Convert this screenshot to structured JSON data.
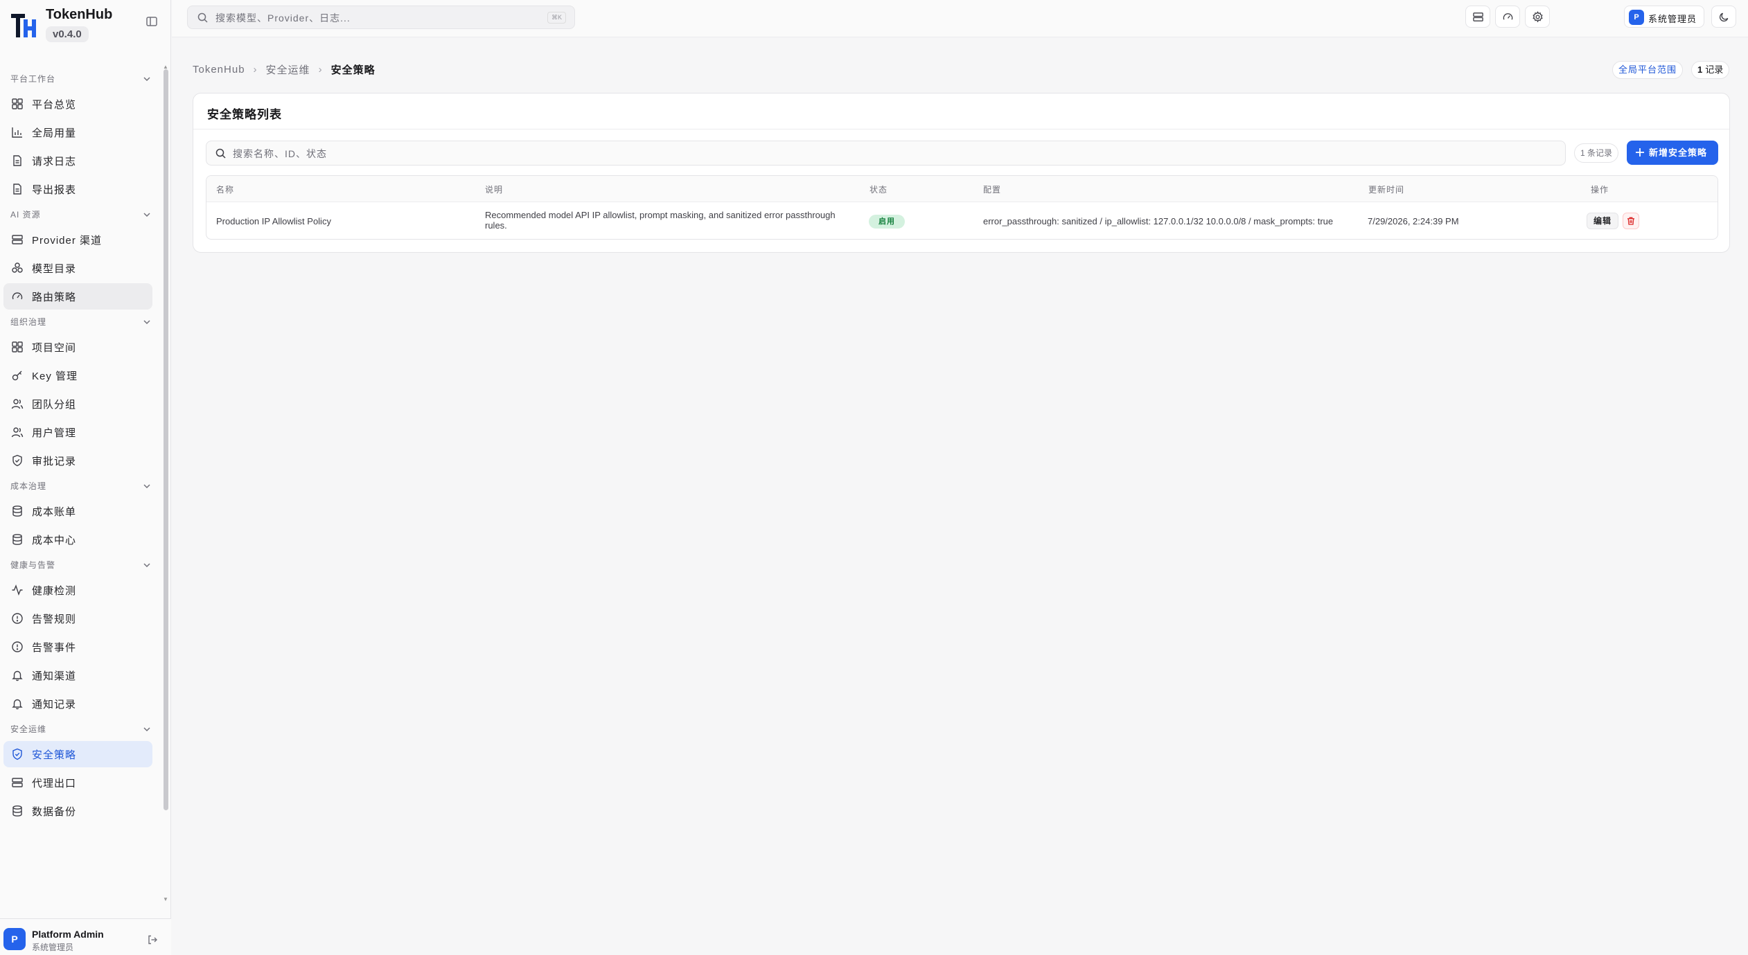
{
  "brand": {
    "name": "TokenHub",
    "version": "v0.4.0"
  },
  "sidebar": {
    "groups": [
      {
        "label": "平台工作台",
        "items": [
          {
            "label": "平台总览",
            "icon": "grid-icon"
          },
          {
            "label": "全局用量",
            "icon": "bar-chart-icon"
          },
          {
            "label": "请求日志",
            "icon": "file-icon"
          },
          {
            "label": "导出报表",
            "icon": "file-icon"
          }
        ]
      },
      {
        "label": "AI 资源",
        "items": [
          {
            "label": "Provider 渠道",
            "icon": "server-icon"
          },
          {
            "label": "模型目录",
            "icon": "boxes-icon"
          },
          {
            "label": "路由策略",
            "icon": "gauge-icon"
          }
        ]
      },
      {
        "label": "组织治理",
        "items": [
          {
            "label": "项目空间",
            "icon": "grid-icon"
          },
          {
            "label": "Key 管理",
            "icon": "key-icon"
          },
          {
            "label": "团队分组",
            "icon": "users-icon"
          },
          {
            "label": "用户管理",
            "icon": "users-icon"
          },
          {
            "label": "审批记录",
            "icon": "shield-check-icon"
          }
        ]
      },
      {
        "label": "成本治理",
        "items": [
          {
            "label": "成本账单",
            "icon": "database-icon"
          },
          {
            "label": "成本中心",
            "icon": "database-icon"
          }
        ]
      },
      {
        "label": "健康与告警",
        "items": [
          {
            "label": "健康检测",
            "icon": "activity-icon"
          },
          {
            "label": "告警规则",
            "icon": "alert-circle-icon"
          },
          {
            "label": "告警事件",
            "icon": "alert-circle-icon"
          },
          {
            "label": "通知渠道",
            "icon": "bell-icon"
          },
          {
            "label": "通知记录",
            "icon": "bell-icon"
          }
        ]
      },
      {
        "label": "安全运维",
        "items": [
          {
            "label": "安全策略",
            "icon": "shield-check-icon"
          },
          {
            "label": "代理出口",
            "icon": "server-icon"
          },
          {
            "label": "数据备份",
            "icon": "database-icon"
          }
        ]
      }
    ]
  },
  "user": {
    "avatar": "P",
    "name": "Platform Admin",
    "role": "系统管理员"
  },
  "topbar": {
    "search_placeholder": "搜索模型、Provider、日志...",
    "shortcut": "⌘K",
    "admin_avatar": "P",
    "admin_label": "系统管理员"
  },
  "breadcrumb": {
    "root": "TokenHub",
    "parent": "安全运维",
    "current": "安全策略"
  },
  "badges": {
    "scope": "全局平台范围",
    "count": "1",
    "count_unit": "记录"
  },
  "card": {
    "title": "安全策略列表",
    "search_placeholder": "搜索名称、ID、状态",
    "record_chip": "1 条记录",
    "new_button": "新增安全策略",
    "columns": [
      "名称",
      "说明",
      "状态",
      "配置",
      "更新时间",
      "操作"
    ],
    "rows": [
      {
        "name": "Production IP Allowlist Policy",
        "description": "Recommended model API IP allowlist, prompt masking, and sanitized error passthrough rules.",
        "status": "启用",
        "config": "error_passthrough: sanitized / ip_allowlist: 127.0.0.1/32 10.0.0.0/8 / mask_prompts: true",
        "updated": "7/29/2026, 2:24:39 PM",
        "edit": "编辑"
      }
    ]
  },
  "colors": {
    "accent": "#2563eb",
    "active_bg": "#e3ebfb",
    "status_bg": "#d4f1df",
    "status_fg": "#15803d",
    "danger": "#dc2626"
  }
}
